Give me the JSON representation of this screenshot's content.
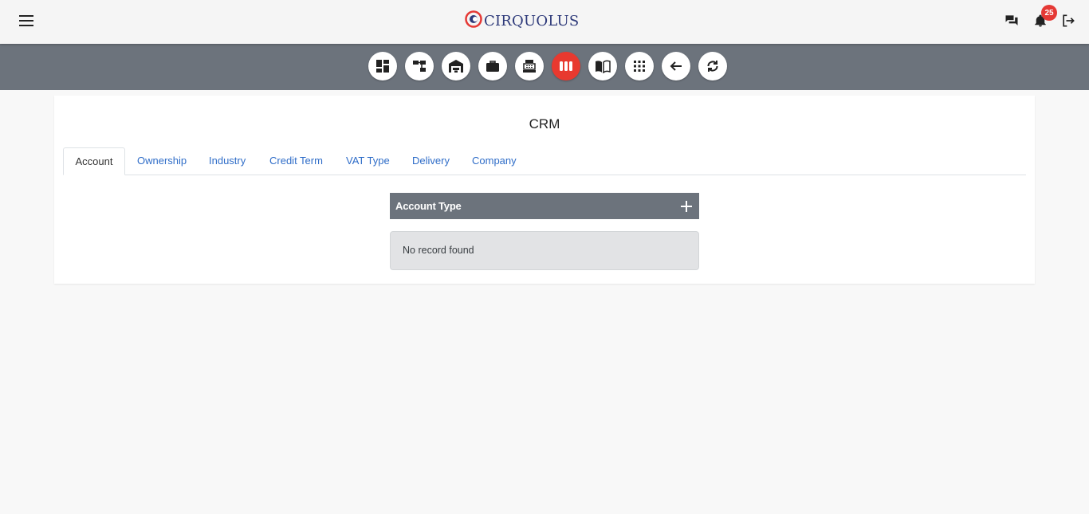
{
  "app": {
    "brand": "CIRQUOLUS",
    "notification_count": "25"
  },
  "header": {
    "menu_icon": "menu-icon",
    "chat_icon": "chat-icon",
    "bell_icon": "bell-icon",
    "logout_icon": "logout-icon"
  },
  "toolbar": {
    "buttons": [
      {
        "icon": "dashboard-icon"
      },
      {
        "icon": "hierarchy-icon"
      },
      {
        "icon": "warehouse-icon"
      },
      {
        "icon": "briefcase-icon"
      },
      {
        "icon": "cash-register-icon"
      },
      {
        "icon": "crm-columns-icon",
        "active": true
      },
      {
        "icon": "book-icon"
      },
      {
        "icon": "apps-grid-icon"
      },
      {
        "icon": "back-arrow-icon"
      },
      {
        "icon": "refresh-icon"
      }
    ],
    "active_color": "#e8392f"
  },
  "page": {
    "title": "CRM",
    "tabs": [
      {
        "label": "Account",
        "active": true
      },
      {
        "label": "Ownership"
      },
      {
        "label": "Industry"
      },
      {
        "label": "Credit Term"
      },
      {
        "label": "VAT Type"
      },
      {
        "label": "Delivery"
      },
      {
        "label": "Company"
      }
    ],
    "panel": {
      "title": "Account Type",
      "add_icon": "plus-icon",
      "empty_message": "No record found"
    }
  },
  "colors": {
    "toolbar_bg": "#6c737c",
    "link": "#2f6dc8",
    "badge": "#e53935",
    "brand_text": "#2e3a7a"
  }
}
